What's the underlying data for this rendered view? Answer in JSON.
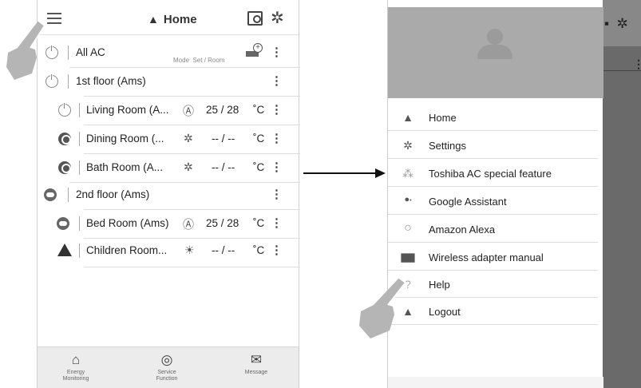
{
  "left_screen": {
    "header": {
      "title": "Home",
      "title_icon": "house-icon",
      "menu_icon": "hamburger-menu-icon",
      "schedule_icon": "schedule-icon",
      "settings_icon": "gear-icon"
    },
    "rows": [
      {
        "name": "All AC",
        "icon": "power-outline",
        "mode": "",
        "temp": "",
        "unit": "",
        "mode_label": "Mode",
        "setroom_label": "Set / Room"
      },
      {
        "name": "1st floor (Ams)",
        "icon": "power-outline",
        "mode": "",
        "temp": "",
        "unit": ""
      },
      {
        "name": "Living Room (A...",
        "icon": "power-outline",
        "mode": "Ⓐ",
        "temp": "25 / 28",
        "unit": "˚C"
      },
      {
        "name": "Dining Room (...",
        "icon": "power-on",
        "mode": "✲",
        "temp": "-- / --",
        "unit": "˚C"
      },
      {
        "name": "Bath Room (A...",
        "icon": "power-on",
        "mode": "✲",
        "temp": "-- / --",
        "unit": "˚C"
      },
      {
        "name": "2nd floor (Ams)",
        "icon": "cloud",
        "mode": "",
        "temp": "",
        "unit": ""
      },
      {
        "name": "Bed Room (Ams)",
        "icon": "cloud",
        "mode": "Ⓐ",
        "temp": "25 / 28",
        "unit": "˚C"
      },
      {
        "name": "Children Room...",
        "icon": "warning",
        "mode": "☀",
        "temp": "-- / --",
        "unit": "˚C"
      }
    ],
    "kebab": "⋮",
    "bottom_nav": [
      {
        "label_line1": "Energy",
        "label_line2": "Monitoring",
        "icon": "energy-house-icon"
      },
      {
        "label_line1": "Service",
        "label_line2": "Function",
        "icon": "service-icon"
      },
      {
        "label_line1": "Message",
        "label_line2": "",
        "icon": "envelope-icon"
      }
    ]
  },
  "drawer": {
    "items": [
      {
        "label": "Home",
        "icon": "house-icon",
        "glyph": "🏠"
      },
      {
        "label": "Settings",
        "icon": "gear-icon",
        "glyph": "⚙"
      },
      {
        "label": "Toshiba AC special feature",
        "icon": "stars-icon",
        "glyph": "⁂"
      },
      {
        "label": "Google Assistant",
        "icon": "google-assistant-icon",
        "glyph": "●"
      },
      {
        "label": "Amazon Alexa",
        "icon": "alexa-ring-icon",
        "glyph": "○"
      },
      {
        "label": "Wireless adapter manual",
        "icon": "book-icon",
        "glyph": "▇"
      },
      {
        "label": "Help",
        "icon": "help-icon",
        "glyph": "?"
      },
      {
        "label": "Logout",
        "icon": "user-icon",
        "glyph": "👤"
      }
    ]
  },
  "colors": {
    "drawer_header": "#aaaaaa",
    "overlay": "#6a6a6a",
    "bottom_nav": "#ececec",
    "text": "#222222"
  }
}
